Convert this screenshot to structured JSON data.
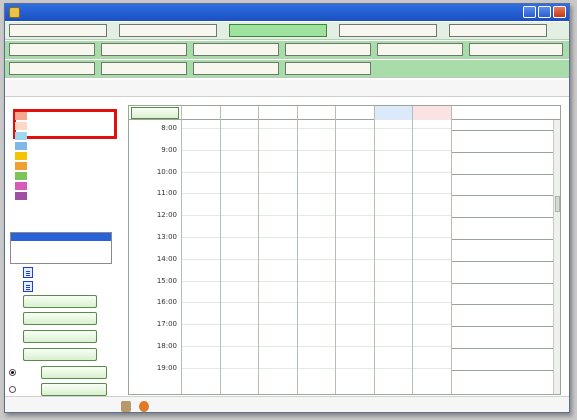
{
  "window": {
    "title": "",
    "minimize_label": "",
    "maximize_label": "",
    "close_label": ""
  },
  "menu_row1": [
    {
      "label": ""
    },
    {
      "label": ""
    },
    {
      "label": "",
      "active": true
    },
    {
      "label": ""
    },
    {
      "label": ""
    }
  ],
  "menu_row2": [
    {
      "label": ""
    },
    {
      "label": ""
    },
    {
      "label": "",
      "disabled": true
    },
    {
      "label": ""
    },
    {
      "label": ""
    },
    {
      "label": ""
    }
  ],
  "menu_row3": [
    {
      "label": ""
    },
    {
      "label": ""
    },
    {
      "label": ""
    },
    {
      "label": ""
    }
  ],
  "menu_row3_link": "",
  "user_info": {
    "code_label": "",
    "code_value": "",
    "name_label": "",
    "name_value": "",
    "age_label": "",
    "age_value": "",
    "sex_value": "",
    "care_level": "",
    "select_link": ""
  },
  "left_panel": {
    "title": "",
    "legend": [
      {
        "label": "",
        "color": "#f4a88e"
      },
      {
        "label": "",
        "color": "#ffd7c7"
      },
      {
        "label": "",
        "color": "#9fd6f0"
      },
      {
        "label": "",
        "color": "#7fb8e8"
      },
      {
        "label": "",
        "color": "#f5c400"
      },
      {
        "label": "",
        "color": "#f0a030"
      },
      {
        "label": "",
        "color": "#7ac45a"
      },
      {
        "label": "",
        "color": "#d85ab8"
      },
      {
        "label": "",
        "color": "#a050a0"
      }
    ],
    "custom_label": "",
    "history_label": "",
    "history_items": [
      ""
    ],
    "new_link": "",
    "copy_new_link": "",
    "buttons": {
      "save": "",
      "undo": "",
      "confirm": "",
      "delete": "",
      "preview": "",
      "print": ""
    },
    "print_mode": {
      "mono_label": "",
      "color_label": "",
      "selected": "mono"
    }
  },
  "schedule": {
    "calc_button": "",
    "days": [
      "",
      "",
      "",
      "",
      "",
      "",
      ""
    ],
    "activity_header": "",
    "times": [
      "8:00",
      "9:00",
      "10:00",
      "11:00",
      "12:00",
      "13:00",
      "14:00",
      "15:00",
      "16:00",
      "17:00",
      "18:00",
      "19:00"
    ]
  },
  "footer": {
    "copyright": "",
    "other_services_link": "",
    "login_user_label": "",
    "login_user_value": ""
  }
}
